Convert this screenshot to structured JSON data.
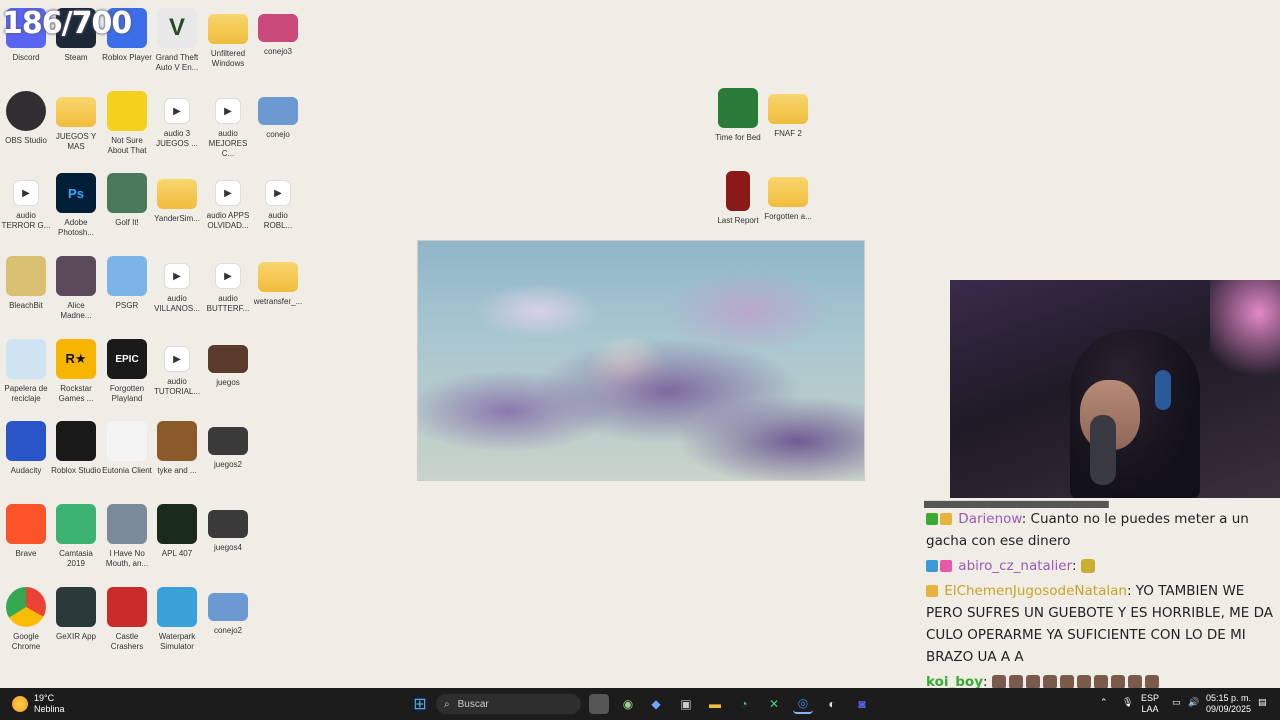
{
  "counter": "186/700",
  "desktop": {
    "icons": [
      {
        "label": "Discord",
        "icon": "discord-icon",
        "color": "#5865f2"
      },
      {
        "label": "Steam",
        "icon": "steam-icon",
        "color": "#1b2838"
      },
      {
        "label": "Roblox Player",
        "icon": "roblox-icon",
        "color": "#3b6ee8"
      },
      {
        "label": "Grand Theft Auto V En...",
        "icon": "gta-icon",
        "color": "#e8e8e8"
      },
      {
        "label": "Unfiltered Windows",
        "icon": "folder-icon",
        "color": "#f0bd3c"
      },
      {
        "label": "conejo3",
        "icon": "image-icon",
        "color": "#c94a7a"
      },
      {
        "label": "OBS Studio",
        "icon": "obs-icon",
        "color": "#302e31"
      },
      {
        "label": "JUEGOS Y MAS",
        "icon": "folder-icon",
        "color": "#f0bd3c"
      },
      {
        "label": "Not Sure About That",
        "icon": "duck-icon",
        "color": "#f5d11d"
      },
      {
        "label": "audio 3 JUEGOS ...",
        "icon": "audio-icon",
        "color": "#ffffff"
      },
      {
        "label": "audio MEJORES C...",
        "icon": "audio-icon",
        "color": "#ffffff"
      },
      {
        "label": "conejo",
        "icon": "image-icon",
        "color": "#6a9ad1"
      },
      {
        "label": "audio TERROR G...",
        "icon": "audio-icon",
        "color": "#ffffff"
      },
      {
        "label": "Adobe Photosh...",
        "icon": "photoshop-icon",
        "color": "#001e36"
      },
      {
        "label": "Golf It!",
        "icon": "golf-icon",
        "color": "#4a7a5a"
      },
      {
        "label": "YanderSim...",
        "icon": "folder-icon",
        "color": "#f0bd3c"
      },
      {
        "label": "audio APPS OLVIDAD...",
        "icon": "audio-icon",
        "color": "#ffffff"
      },
      {
        "label": "audio ROBL...",
        "icon": "audio-icon",
        "color": "#ffffff"
      },
      {
        "label": "BleachBit",
        "icon": "broom-icon",
        "color": "#d8c070"
      },
      {
        "label": "Alice Madne...",
        "icon": "alice-icon",
        "color": "#5a4a5a"
      },
      {
        "label": "PSGR",
        "icon": "mountain-icon",
        "color": "#7ab4e8"
      },
      {
        "label": "audio VILLANOS...",
        "icon": "audio-icon",
        "color": "#ffffff"
      },
      {
        "label": "audio BUTTERF...",
        "icon": "audio-icon",
        "color": "#ffffff"
      },
      {
        "label": "wetransfer_...",
        "icon": "folder-icon",
        "color": "#f0bd3c"
      },
      {
        "label": "Papelera de reciclaje",
        "icon": "recycle-bin-icon",
        "color": "#cfe3f2"
      },
      {
        "label": "Rockstar Games ...",
        "icon": "rockstar-icon",
        "color": "#f7b500"
      },
      {
        "label": "Forgotten Playland",
        "icon": "epic-games-icon",
        "color": "#1a1a1a"
      },
      {
        "label": "audio TUTORIAL...",
        "icon": "audio-icon",
        "color": "#ffffff"
      },
      {
        "label": "juegos",
        "icon": "image-icon",
        "color": "#5a3a2a"
      },
      {
        "label": "",
        "icon": "blank",
        "color": "#efede6"
      },
      {
        "label": "Audacity",
        "icon": "audacity-icon",
        "color": "#2a55c9"
      },
      {
        "label": "Roblox Studio",
        "icon": "roblox-studio-icon",
        "color": "#1a1a1a"
      },
      {
        "label": "Eutonia Client",
        "icon": "eutonia-icon",
        "color": "#f4f4f4"
      },
      {
        "label": "tyke and ...",
        "icon": "tyke-icon",
        "color": "#8a5a2a"
      },
      {
        "label": "juegos2",
        "icon": "image-icon",
        "color": "#3a3a3a"
      },
      {
        "label": "",
        "icon": "blank",
        "color": "#efede6"
      },
      {
        "label": "Brave",
        "icon": "brave-icon",
        "color": "#fb542b"
      },
      {
        "label": "Camtasia 2019",
        "icon": "camtasia-icon",
        "color": "#3cb371"
      },
      {
        "label": "I Have No Mouth, an...",
        "icon": "mouth-icon",
        "color": "#7a8a9a"
      },
      {
        "label": "APL 407",
        "icon": "apl-icon",
        "color": "#1a2a1a"
      },
      {
        "label": "juegos4",
        "icon": "image-icon",
        "color": "#3a3a3a"
      },
      {
        "label": "",
        "icon": "blank",
        "color": "#efede6"
      },
      {
        "label": "Google Chrome",
        "icon": "chrome-icon",
        "color": "#4285f4"
      },
      {
        "label": "GeXIR App",
        "icon": "gexir-icon",
        "color": "#2a3a3a"
      },
      {
        "label": "Castle Crashers",
        "icon": "castle-icon",
        "color": "#c92a2a"
      },
      {
        "label": "Waterpark Simulator",
        "icon": "waterpark-icon",
        "color": "#3aa0d8"
      },
      {
        "label": "conejo2",
        "icon": "image-icon",
        "color": "#6a9ad1"
      }
    ],
    "right_icons": [
      {
        "label": "Time for Bed",
        "icon": "game-boy-icon",
        "color": "#2a7a3a"
      },
      {
        "label": "FNAF 2",
        "icon": "folder-icon",
        "color": "#f0bd3c"
      },
      {
        "label": "Last Report",
        "icon": "document-icon",
        "color": "#8a1a1a"
      },
      {
        "label": "Forgotten a...",
        "icon": "folder-icon",
        "color": "#f0bd3c"
      }
    ]
  },
  "chat": {
    "messages": [
      {
        "user": "Darienow",
        "user_color": "#9b59b6",
        "text": ": Cuanto no le puedes meter a un gacha con ese dinero"
      },
      {
        "user": "abiro_cz_natalier",
        "user_color": "#9b59b6",
        "text": ": "
      },
      {
        "user": "ElChemenJugosodeNatalan",
        "user_color": "#c9a227",
        "text": ": YO TAMBIEN WE PERO SUFRES UN GUEBOTE Y ES HORRIBLE, ME DA CULO OPERARME YA SUFICIENTE CON LO DE MI BRAZO UA A A"
      },
      {
        "user": "koi_boy",
        "user_color": "#3aaa35",
        "text": ":"
      }
    ]
  },
  "taskbar": {
    "weather_temp": "19°C",
    "weather_desc": "Neblina",
    "search_placeholder": "Buscar",
    "lang_top": "ESP",
    "lang_bottom": "LAA",
    "time": "05:15 p. m.",
    "date": "09/09/2025"
  }
}
